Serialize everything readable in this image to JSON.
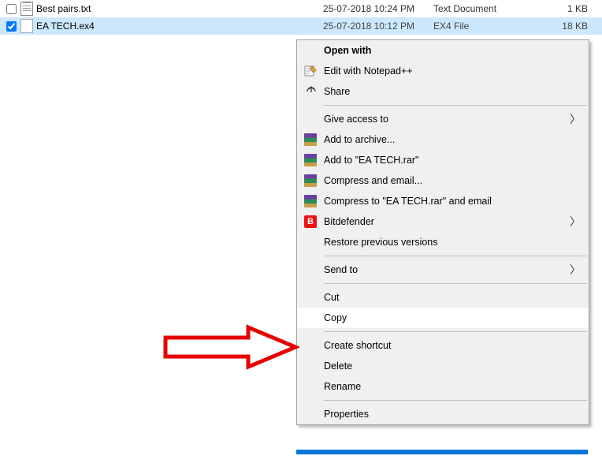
{
  "files": [
    {
      "name": "Best pairs.txt",
      "date": "25-07-2018 10:24 PM",
      "type": "Text Document",
      "size": "1 KB"
    },
    {
      "name": "EA TECH.ex4",
      "date": "25-07-2018 10:12 PM",
      "type": "EX4 File",
      "size": "18 KB"
    }
  ],
  "menu": {
    "open_with": "Open with",
    "edit_npp": "Edit with Notepad++",
    "share": "Share",
    "give_access": "Give access to",
    "add_archive": "Add to archive...",
    "add_rar": "Add to \"EA TECH.rar\"",
    "compress_email": "Compress and email...",
    "compress_rar_email": "Compress to \"EA TECH.rar\" and email",
    "bitdefender": "Bitdefender",
    "restore": "Restore previous versions",
    "send_to": "Send to",
    "cut": "Cut",
    "copy": "Copy",
    "create_shortcut": "Create shortcut",
    "delete": "Delete",
    "rename": "Rename",
    "properties": "Properties",
    "bitdef_letter": "B"
  }
}
